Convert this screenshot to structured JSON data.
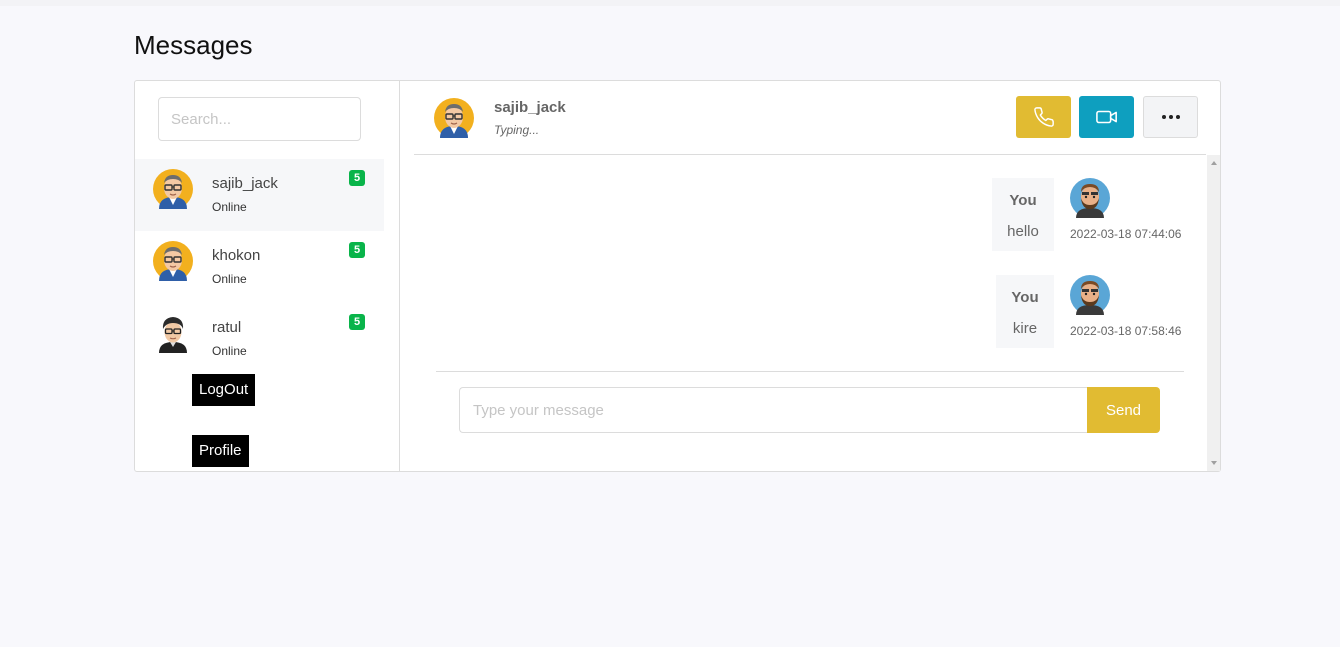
{
  "page": {
    "title": "Messages"
  },
  "search": {
    "placeholder": "Search..."
  },
  "contacts": [
    {
      "name": "sajib_jack",
      "status": "Online",
      "unread": "5",
      "active": true,
      "avatar": "avatar-glasses"
    },
    {
      "name": "khokon",
      "status": "Online",
      "unread": "5",
      "active": false,
      "avatar": "avatar-glasses"
    },
    {
      "name": "ratul",
      "status": "Online",
      "unread": "5",
      "active": false,
      "avatar": "avatar-dark-hair"
    }
  ],
  "sidebar": {
    "logout_label": "LogOut",
    "profile_label": "Profile"
  },
  "chat": {
    "header": {
      "name": "sajib_jack",
      "status": "Typing...",
      "call_icon": "phone-icon",
      "video_icon": "video-camera-icon",
      "more_icon": "more-horizontal-icon"
    },
    "messages": [
      {
        "sender": "You",
        "text": "hello",
        "time": "2022-03-18 07:44:06",
        "avatar": "avatar-bearded"
      },
      {
        "sender": "You",
        "text": "kire",
        "time": "2022-03-18 07:58:46",
        "avatar": "avatar-bearded"
      }
    ],
    "composer": {
      "placeholder": "Type your message",
      "send_label": "Send"
    }
  },
  "colors": {
    "accent_yellow": "#e1bb32",
    "accent_teal": "#0e9fbf",
    "badge_green": "#09b44a",
    "background": "#f8f8fc"
  }
}
